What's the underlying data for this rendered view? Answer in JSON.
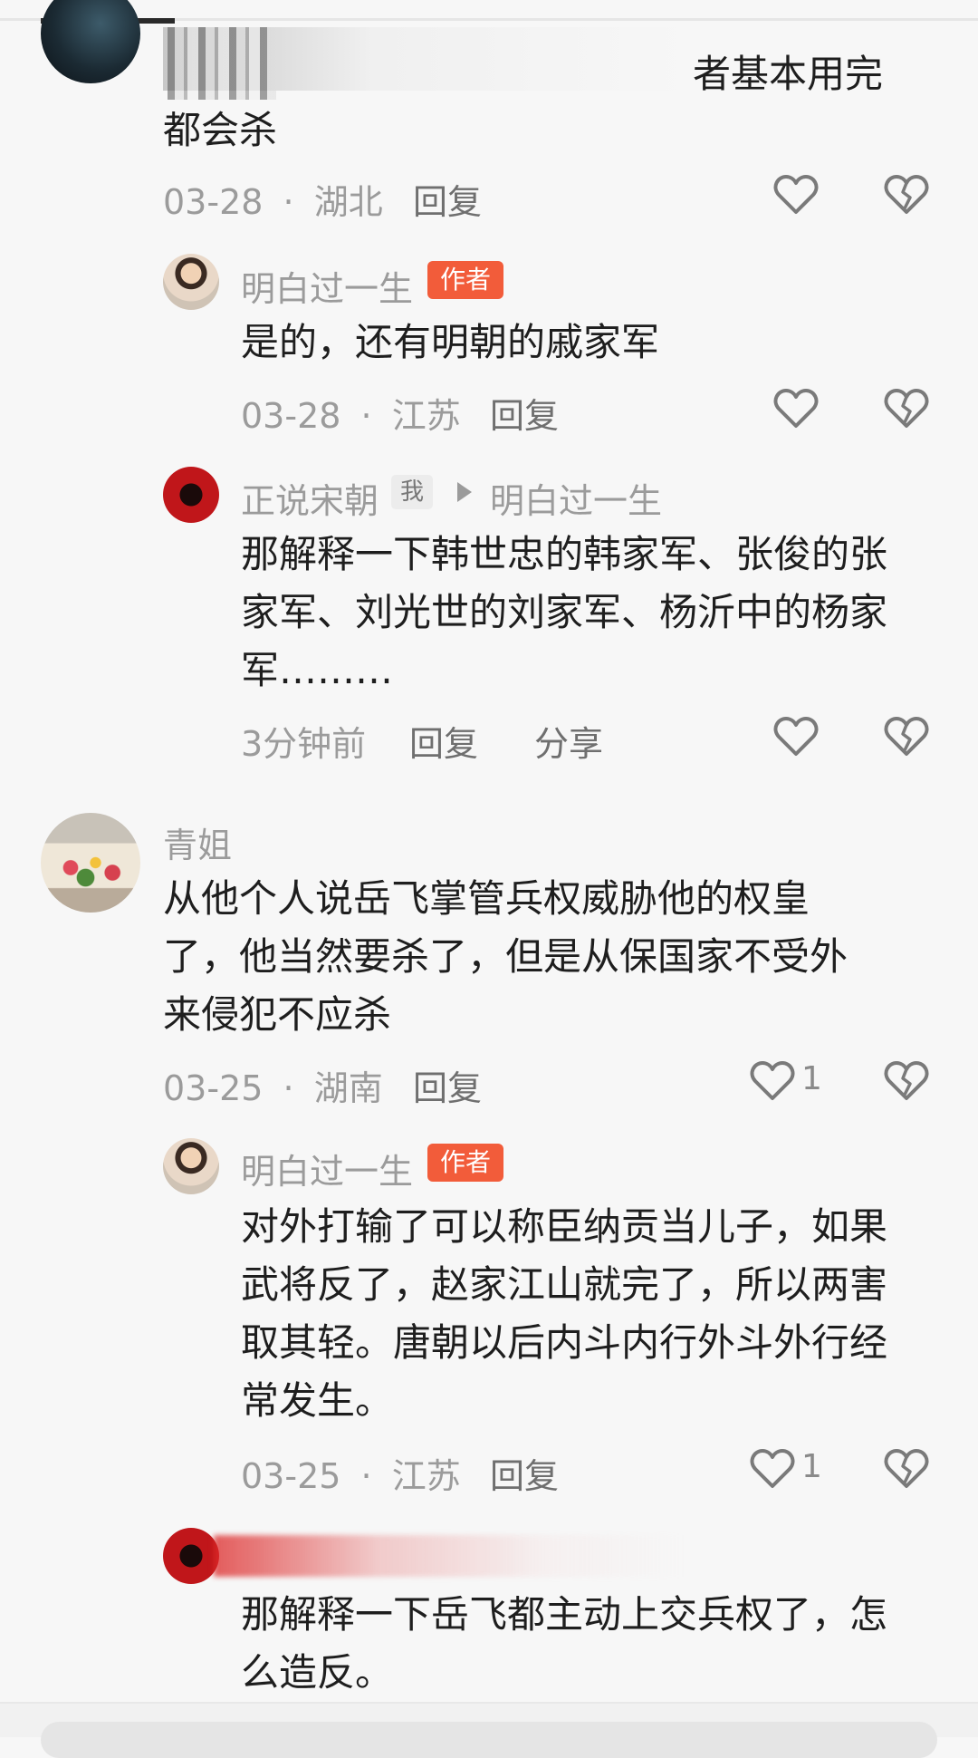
{
  "comments": {
    "c0": {
      "text_partial": "者基本用完",
      "text_line2": "都会杀",
      "date": "03-28",
      "location": "湖北",
      "reply": "回复"
    },
    "r1": {
      "name": "明白过一生",
      "badge": "作者",
      "text": "是的，还有明朝的戚家军",
      "date": "03-28",
      "location": "江苏",
      "reply": "回复"
    },
    "r2": {
      "name": "正说宋朝",
      "me_tag": "我",
      "reply_to": "明白过一生",
      "lines": [
        "那解释一下韩世忠的韩家军、张俊的张",
        "家军、刘光世的刘家军、杨沂中的杨家",
        "军………"
      ],
      "time": "3分钟前",
      "reply": "回复",
      "share": "分享"
    },
    "c1": {
      "name": "青姐",
      "lines": [
        "从他个人说岳飞掌管兵权威胁他的权皇",
        "了，他当然要杀了，但是从保国家不受外",
        "来侵犯不应杀"
      ],
      "date": "03-25",
      "location": "湖南",
      "reply": "回复",
      "likes": "1"
    },
    "r3": {
      "name": "明白过一生",
      "badge": "作者",
      "lines": [
        "对外打输了可以称臣纳贡当儿子，如果",
        "武将反了，赵家江山就完了，所以两害",
        "取其轻。唐朝以后内斗内行外斗外行经",
        "常发生。"
      ],
      "date": "03-25",
      "location": "江苏",
      "reply": "回复",
      "likes": "1"
    },
    "r4": {
      "lines": [
        "那解释一下岳飞都主动上交兵权了，怎",
        "么造反。"
      ]
    }
  },
  "separator": "·",
  "colors": {
    "author_badge": "#f25c3a",
    "meta_gray": "#9b9b9b",
    "text": "#1e1e1e"
  },
  "icons": [
    "heart-outline-icon",
    "broken-heart-icon",
    "play-triangle-icon"
  ]
}
